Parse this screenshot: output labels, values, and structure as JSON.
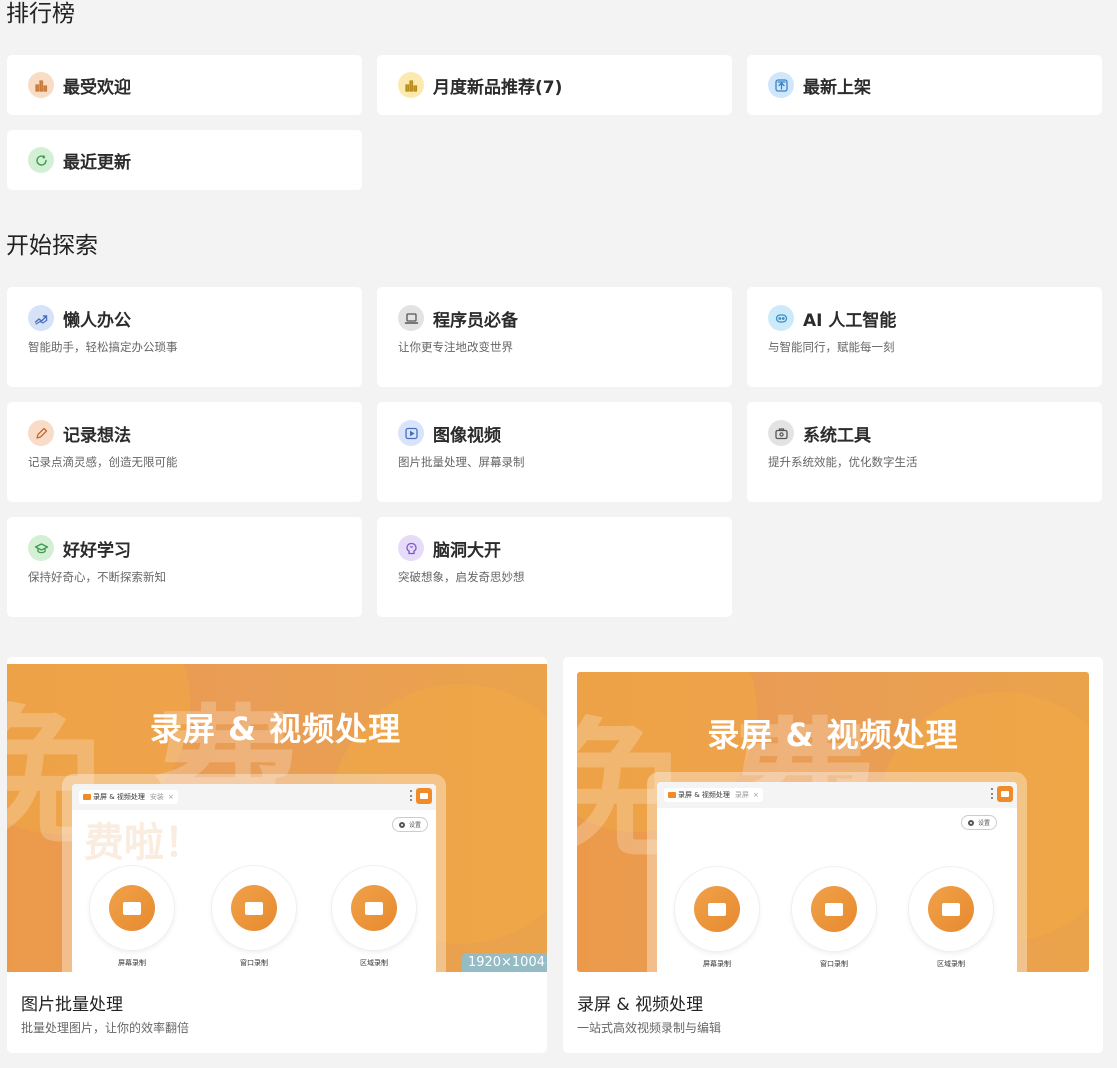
{
  "ranking": {
    "title": "排行榜",
    "items": [
      {
        "label": "最受欢迎",
        "icon": "bar-chart-icon",
        "color": "#f8dcc4",
        "stroke": "#c77a3b"
      },
      {
        "label": "月度新品推荐(7)",
        "icon": "bar-chart-icon",
        "color": "#fbeab0",
        "stroke": "#b88a1a"
      },
      {
        "label": "最新上架",
        "icon": "upload-icon",
        "color": "#cfe6fb",
        "stroke": "#3b82c4"
      },
      {
        "label": "最近更新",
        "icon": "refresh-icon",
        "color": "#d4f0d4",
        "stroke": "#3c9a4e"
      }
    ]
  },
  "explore": {
    "title": "开始探索",
    "items": [
      {
        "label": "懒人办公",
        "desc": "智能助手，轻松搞定办公琐事",
        "icon": "trend-icon",
        "color": "#d6e2f8",
        "stroke": "#4a6fb8"
      },
      {
        "label": "程序员必备",
        "desc": "让你更专注地改变世界",
        "icon": "laptop-icon",
        "color": "#e3e3e3",
        "stroke": "#555555"
      },
      {
        "label": "AI 人工智能",
        "desc": "与智能同行，赋能每一刻",
        "icon": "robot-icon",
        "color": "#cdeafa",
        "stroke": "#3b8ec4"
      },
      {
        "label": "记录想法",
        "desc": "记录点滴灵感，创造无限可能",
        "icon": "pencil-icon",
        "color": "#f9dcc8",
        "stroke": "#c06a36"
      },
      {
        "label": "图像视频",
        "desc": "图片批量处理、屏幕录制",
        "icon": "play-icon",
        "color": "#d8e4fb",
        "stroke": "#4a6fb8"
      },
      {
        "label": "系统工具",
        "desc": "提升系统效能，优化数字生活",
        "icon": "toolbox-icon",
        "color": "#e3e3e3",
        "stroke": "#555555"
      },
      {
        "label": "好好学习",
        "desc": "保持好奇心，不断探索新知",
        "icon": "graduation-cap-icon",
        "color": "#d4f0d4",
        "stroke": "#3c9a4e"
      },
      {
        "label": "脑洞大开",
        "desc": "突破想象，启发奇思妙想",
        "icon": "brain-icon",
        "color": "#e6dbf9",
        "stroke": "#7b56c4"
      }
    ]
  },
  "features": [
    {
      "title": "图片批量处理",
      "desc": "批量处理图片，让你的效率翻倍",
      "banner": {
        "headline": "录屏 & 视频处理",
        "decor_text": "免费",
        "decor_text_2": "费啦！",
        "dimension_badge": "1920×1004",
        "tab_label": "录屏 & 视频处理",
        "tab_tag": "安装",
        "settings_label": "设置",
        "modes": [
          "屏幕录制",
          "窗口录制",
          "区域录制"
        ]
      }
    },
    {
      "title": "录屏 & 视频处理",
      "desc": "一站式高效视频录制与编辑",
      "banner": {
        "headline": "录屏 & 视频处理",
        "decor_text": "免费",
        "tab_label": "录屏 & 视频处理",
        "tab_tag": "录屏",
        "settings_label": "设置",
        "modes": [
          "屏幕录制",
          "窗口录制",
          "区域录制"
        ]
      }
    }
  ],
  "colors": {
    "accent": "#ec9a4a",
    "page_bg": "#f3f3f3",
    "card_bg": "#ffffff"
  }
}
